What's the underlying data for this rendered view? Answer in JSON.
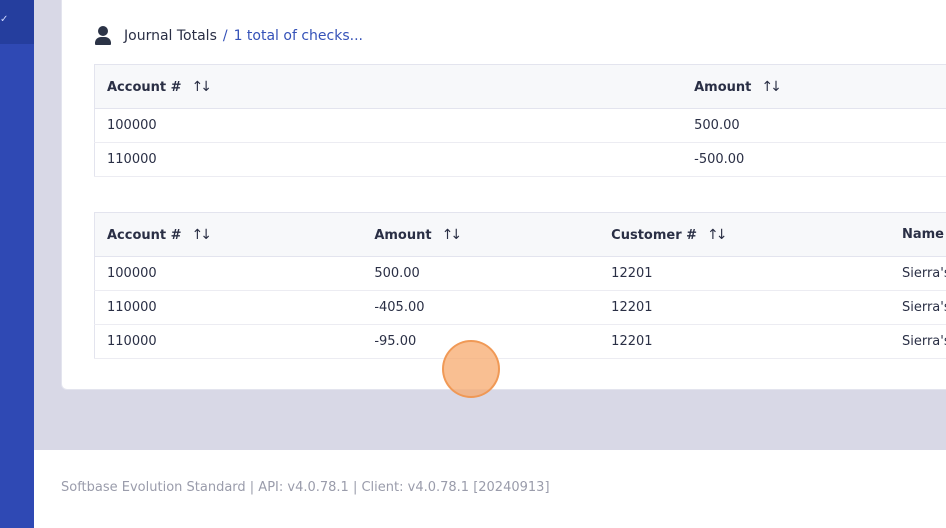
{
  "sidebar": {
    "active_icon": "check-icon"
  },
  "header": {
    "icon": "user-icon",
    "title": "Journal Totals",
    "separator": "/",
    "link": "1 total of checks..."
  },
  "journal_totals_table": {
    "columns": [
      "Account #",
      "Amount"
    ],
    "rows": [
      [
        "100000",
        "500.00"
      ],
      [
        "110000",
        "-500.00"
      ]
    ]
  },
  "checks_table": {
    "columns": [
      "Account #",
      "Amount",
      "Customer #",
      "Name"
    ],
    "rows": [
      [
        "100000",
        "500.00",
        "12201",
        "Sierra's"
      ],
      [
        "110000",
        "-405.00",
        "12201",
        "Sierra's"
      ],
      [
        "110000",
        "-95.00",
        "12201",
        "Sierra's"
      ]
    ]
  },
  "footer": {
    "text": "Softbase Evolution Standard | API: v4.0.78.1 | Client: v4.0.78.1 [20240913]"
  },
  "sort_icon_glyph": "↑↓"
}
